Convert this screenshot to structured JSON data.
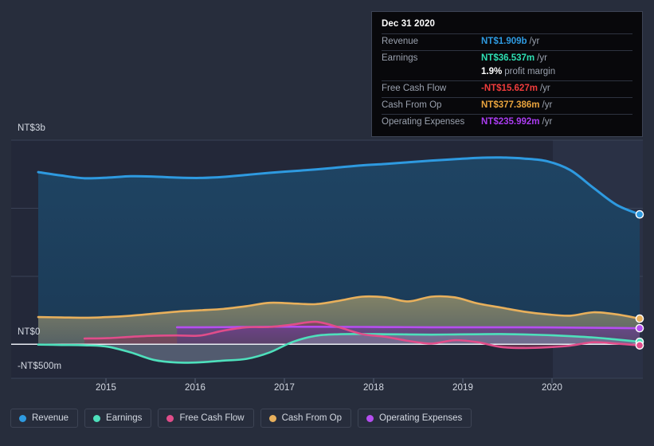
{
  "tooltip": {
    "title": "Dec 31 2020",
    "rows": [
      {
        "label": "Revenue",
        "value": "NT$1.909b",
        "unit": "/yr",
        "color": "#2e9ae0"
      },
      {
        "label": "Earnings",
        "value": "NT$36.537m",
        "unit": "/yr",
        "color": "#2ee0b4"
      },
      {
        "label": "",
        "value": "1.9%",
        "unit": "profit margin",
        "color": "#ffffff"
      },
      {
        "label": "Free Cash Flow",
        "value": "-NT$15.627m",
        "unit": "/yr",
        "color": "#f03c3c"
      },
      {
        "label": "Cash From Op",
        "value": "NT$377.386m",
        "unit": "/yr",
        "color": "#e8a33d"
      },
      {
        "label": "Operating Expenses",
        "value": "NT$235.992m",
        "unit": "/yr",
        "color": "#aa3cf0"
      }
    ]
  },
  "legend": {
    "items": [
      {
        "label": "Revenue",
        "color": "#2e9ae0"
      },
      {
        "label": "Earnings",
        "color": "#4ee0bc"
      },
      {
        "label": "Free Cash Flow",
        "color": "#e04d8a"
      },
      {
        "label": "Cash From Op",
        "color": "#e8b05c"
      },
      {
        "label": "Operating Expenses",
        "color": "#b54ef0"
      }
    ]
  },
  "axes": {
    "y_labels": [
      "NT$3b",
      "NT$0",
      "-NT$500m"
    ],
    "x_labels": [
      "2015",
      "2016",
      "2017",
      "2018",
      "2019",
      "2020"
    ]
  },
  "chart_data": {
    "type": "area",
    "title": "",
    "xlabel": "",
    "ylabel": "NT$",
    "ylim": [
      -500000000,
      3500000000
    ],
    "y_ticks": [
      {
        "label": "NT$3b",
        "value": 3000000000
      },
      {
        "label": "NT$0",
        "value": 0
      },
      {
        "label": "-NT$500m",
        "value": -500000000
      }
    ],
    "x_ticks": [
      "2015",
      "2016",
      "2017",
      "2018",
      "2019",
      "2020"
    ],
    "grid": true,
    "legend_position": "bottom",
    "forecast_start": "2020.3",
    "currency": "NT$",
    "series": [
      {
        "name": "Revenue",
        "color": "#2e9ae0",
        "fill": "#1e4160",
        "x": [
          2014.5,
          2014.75,
          2015.0,
          2015.25,
          2015.5,
          2015.75,
          2016.0,
          2016.25,
          2016.5,
          2016.75,
          2017.0,
          2017.25,
          2017.5,
          2017.75,
          2018.0,
          2018.25,
          2018.5,
          2018.75,
          2019.0,
          2019.25,
          2019.5,
          2019.75,
          2020.0,
          2020.25,
          2020.5,
          2020.75,
          2021.0
        ],
        "values": [
          2530,
          2480,
          2440,
          2450,
          2470,
          2465,
          2450,
          2445,
          2460,
          2490,
          2520,
          2545,
          2570,
          2600,
          2630,
          2650,
          2675,
          2700,
          2720,
          2740,
          2745,
          2730,
          2690,
          2560,
          2300,
          2050,
          1909
        ],
        "units": "NT$m"
      },
      {
        "name": "Cash From Op",
        "color": "#e8b05c",
        "fill": "#6f6f57",
        "x": [
          2014.5,
          2014.75,
          2015.0,
          2015.25,
          2015.5,
          2015.75,
          2016.0,
          2016.25,
          2016.5,
          2016.75,
          2017.0,
          2017.25,
          2017.5,
          2017.75,
          2018.0,
          2018.25,
          2018.5,
          2018.75,
          2019.0,
          2019.25,
          2019.5,
          2019.75,
          2020.0,
          2020.25,
          2020.5,
          2020.75,
          2021.0
        ],
        "values": [
          400,
          395,
          390,
          400,
          420,
          450,
          480,
          500,
          520,
          560,
          610,
          600,
          590,
          640,
          700,
          690,
          630,
          700,
          690,
          600,
          540,
          480,
          440,
          420,
          470,
          440,
          377
        ],
        "units": "NT$m"
      },
      {
        "name": "Operating Expenses",
        "color": "#b54ef0",
        "fill": "#5a3a78",
        "x": [
          2016.0,
          2016.25,
          2016.5,
          2016.75,
          2017.0,
          2017.25,
          2017.5,
          2017.75,
          2018.0,
          2018.25,
          2018.5,
          2018.75,
          2019.0,
          2019.25,
          2019.5,
          2019.75,
          2020.0,
          2020.25,
          2020.5,
          2020.75,
          2021.0
        ],
        "values": [
          250,
          250,
          252,
          255,
          258,
          258,
          257,
          256,
          255,
          253,
          252,
          250,
          250,
          250,
          250,
          250,
          248,
          245,
          242,
          240,
          236
        ],
        "units": "NT$m"
      },
      {
        "name": "Earnings",
        "color": "#4ee0bc",
        "fill": "#3a5f6e",
        "x": [
          2014.5,
          2014.75,
          2015.0,
          2015.25,
          2015.5,
          2015.75,
          2016.0,
          2016.25,
          2016.5,
          2016.75,
          2017.0,
          2017.25,
          2017.5,
          2017.75,
          2018.0,
          2018.25,
          2018.5,
          2018.75,
          2019.0,
          2019.25,
          2019.5,
          2019.75,
          2020.0,
          2020.25,
          2020.5,
          2020.75,
          2021.0
        ],
        "values": [
          -5,
          -10,
          -15,
          -35,
          -120,
          -230,
          -268,
          -265,
          -240,
          -215,
          -120,
          35,
          125,
          148,
          150,
          148,
          145,
          142,
          145,
          148,
          150,
          145,
          135,
          120,
          100,
          70,
          37
        ],
        "units": "NT$m"
      },
      {
        "name": "Free Cash Flow",
        "color": "#e04d8a",
        "fill": "#7a3450",
        "x": [
          2015.0,
          2015.25,
          2015.5,
          2015.75,
          2016.0,
          2016.25,
          2016.5,
          2016.75,
          2017.0,
          2017.25,
          2017.5,
          2017.75,
          2018.0,
          2018.25,
          2018.5,
          2018.75,
          2019.0,
          2019.25,
          2019.5,
          2019.75,
          2020.0,
          2020.25,
          2020.5,
          2020.75,
          2021.0
        ],
        "values": [
          85,
          90,
          110,
          125,
          130,
          128,
          200,
          250,
          255,
          290,
          330,
          250,
          150,
          110,
          50,
          10,
          60,
          30,
          -40,
          -55,
          -45,
          -20,
          30,
          10,
          -16
        ],
        "units": "NT$m"
      }
    ]
  }
}
